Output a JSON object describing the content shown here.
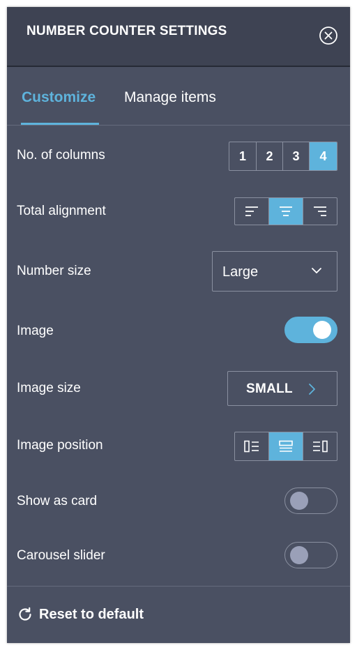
{
  "header": {
    "title": "NUMBER COUNTER SETTINGS",
    "close_icon": "close-circle-icon"
  },
  "tabs": [
    {
      "label": "Customize",
      "active": true
    },
    {
      "label": "Manage items",
      "active": false
    }
  ],
  "settings": {
    "columns": {
      "label": "No. of columns",
      "options": [
        "1",
        "2",
        "3",
        "4"
      ],
      "selected": "4"
    },
    "total_alignment": {
      "label": "Total alignment",
      "options": [
        "align-left-icon",
        "align-center-icon",
        "align-right-icon"
      ],
      "selected": "center"
    },
    "number_size": {
      "label": "Number size",
      "value": "Large"
    },
    "image": {
      "label": "Image",
      "enabled": true
    },
    "image_size": {
      "label": "Image size",
      "value": "SMALL"
    },
    "image_position": {
      "label": "Image position",
      "options": [
        "image-left-icon",
        "image-top-icon",
        "image-right-icon"
      ],
      "selected": "top"
    },
    "show_as_card": {
      "label": "Show as card",
      "enabled": false
    },
    "carousel_slider": {
      "label": "Carousel slider",
      "enabled": false
    }
  },
  "footer": {
    "reset_label": "Reset to default",
    "reset_icon": "refresh-icon"
  },
  "colors": {
    "panel_bg": "#4a5062",
    "header_bg": "#3e4353",
    "accent": "#5eb3dc",
    "border": "#8a90a0",
    "knob_off": "#9aa0b8"
  }
}
